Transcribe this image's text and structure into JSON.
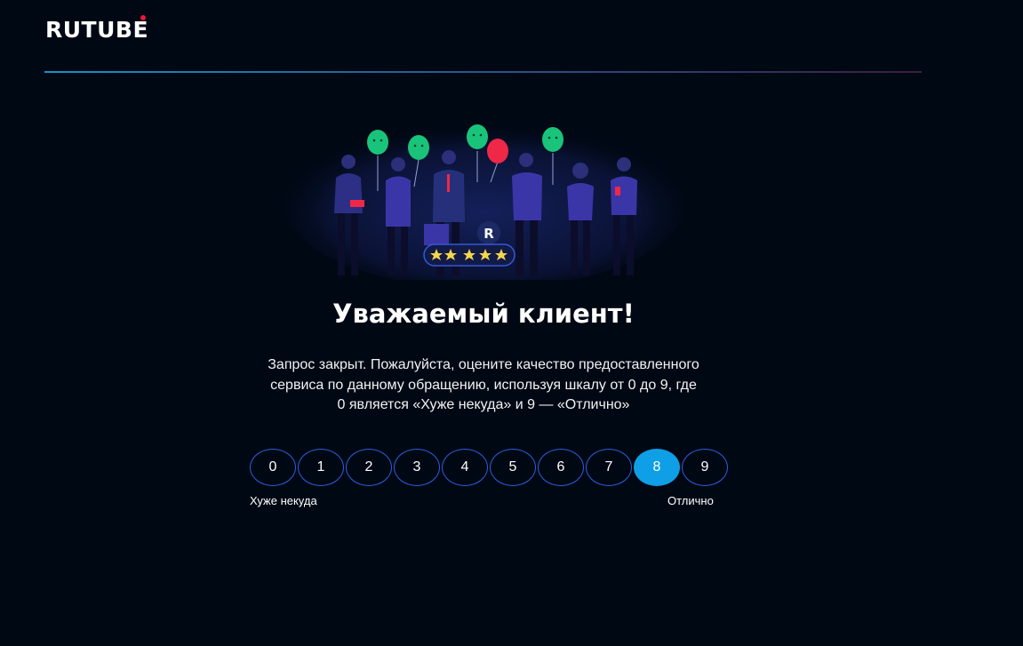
{
  "brand": {
    "name": "RUTUBE",
    "dot_color": "#ED143B"
  },
  "illustration": {
    "icon": "people-with-balloons-illustration",
    "badge_letter": "R",
    "stars_count": 5
  },
  "feedback": {
    "title": "Уважаемый клиент!",
    "description": {
      "line1": "Запрос закрыт. Пожалуйста, оцените качество предоставленного",
      "line2": "сервиса по данному обращению, используя шкалу от 0 до 9, где",
      "line3": "0 является «Хуже некуда» и 9 — «Отлично»"
    },
    "scale": {
      "options": [
        "0",
        "1",
        "2",
        "3",
        "4",
        "5",
        "6",
        "7",
        "8",
        "9"
      ],
      "selected": "8",
      "min_label": "Хуже некуда",
      "max_label": "Отлично"
    }
  },
  "colors": {
    "background": "#000814",
    "accent": "#0F9FE6",
    "button_border": "#2B5FE0"
  }
}
